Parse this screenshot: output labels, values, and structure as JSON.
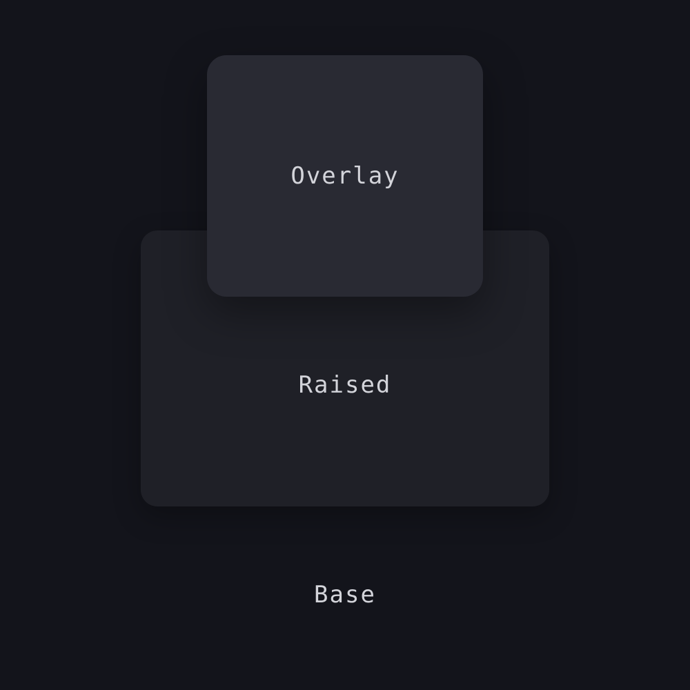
{
  "surfaces": {
    "overlay": {
      "label": "Overlay",
      "color": "#292a33"
    },
    "raised": {
      "label": "Raised",
      "color": "#1f2027"
    },
    "base": {
      "label": "Base",
      "color": "#13141b"
    }
  },
  "colors": {
    "text": "#d3d4da"
  }
}
